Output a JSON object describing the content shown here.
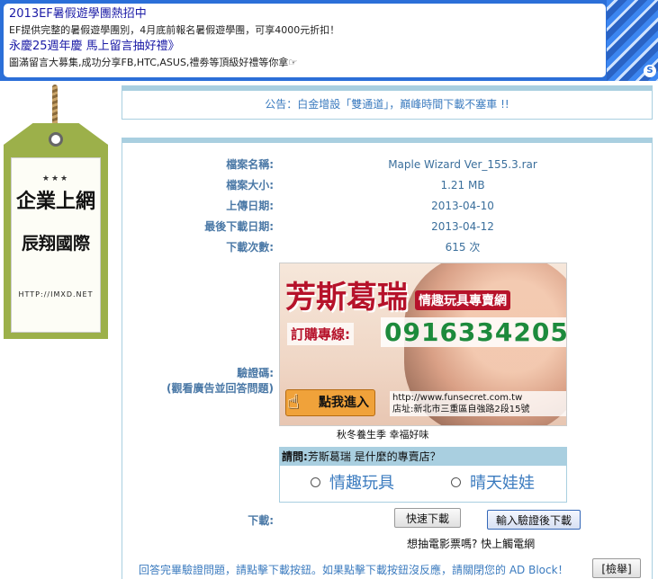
{
  "top_ad": {
    "title1": "2013EF暑假遊學團熱招中",
    "desc1": "EF提供完整的暑假遊學團別，4月底前報名暑假遊學團，可享4000元折扣！",
    "title2": "永慶25週年慶 馬上留言抽好禮》",
    "desc2": "圖滿留言大募集,成功分享FB,HTC,ASUS,禮劵等頂級好禮等你拿☞"
  },
  "sign": {
    "stars": "★★★",
    "line1": "企業上網",
    "line2": "辰翔國際",
    "url": "HTTP://IMXD.NET"
  },
  "notice": "公告：白金增設「雙通道」，巔峰時間下載不塞車 !!",
  "file_info": {
    "rows": [
      {
        "label": "檔案名稱:",
        "value": "Maple Wizard Ver_155.3.rar"
      },
      {
        "label": "檔案大小:",
        "value": "1.21 MB"
      },
      {
        "label": "上傳日期:",
        "value": "2013-04-10"
      },
      {
        "label": "最後下載日期:",
        "value": "2013-04-12"
      },
      {
        "label": "下載次數:",
        "value": "615 次"
      }
    ]
  },
  "captcha": {
    "label_line1": "驗證碼:",
    "label_line2": "(觀看廣告並回答問題)",
    "banner": {
      "brand": "芳斯葛瑞",
      "sub": "情趣玩具專賣網",
      "order_label": "訂購專線:",
      "phone": "0916334205",
      "click_label": "點我進入",
      "url": "http://www.funsecret.com.tw",
      "address": "店址:新北市三重區自強路2段15號"
    },
    "caption": "秋冬養生季 幸福好味",
    "question_prefix": "請問:",
    "question_text": "芳斯葛瑞 是什麼的專賣店？",
    "option1": "情趣玩具",
    "option2": "晴天娃娃"
  },
  "download": {
    "label": "下載:",
    "fast_button": "快速下載",
    "verify_button": "輸入驗證後下載",
    "movie_link": "想抽電影票嗎? 快上觸電網"
  },
  "footer": {
    "note": "回答完畢驗證問題，請點擊下載按鈕。如果點擊下載按鈕沒反應，請關閉您的 AD Block！",
    "report_button": "[檢舉]"
  }
}
